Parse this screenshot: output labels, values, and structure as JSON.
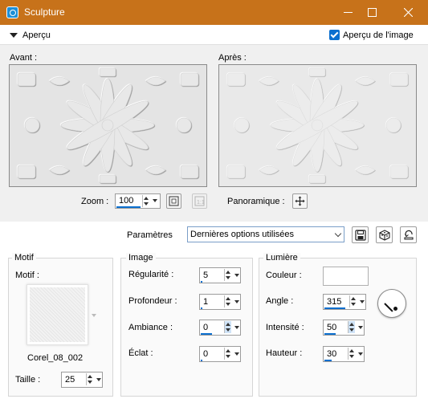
{
  "window": {
    "title": "Sculpture"
  },
  "preview_header": {
    "label": "Aperçu",
    "checkbox_label": "Aperçu de l'image",
    "checkbox_checked": true
  },
  "previews": {
    "before_label": "Avant :",
    "after_label": "Après :"
  },
  "zoom": {
    "label": "Zoom :",
    "value": "100"
  },
  "panoramique": {
    "label": "Panoramique :"
  },
  "parametres": {
    "label": "Paramètres",
    "selected": "Dernières options utilisées"
  },
  "motif": {
    "group_title": "Motif",
    "field_label": "Motif :",
    "pattern_name": "Corel_08_002",
    "size_label": "Taille :",
    "size_value": "25"
  },
  "image": {
    "group_title": "Image",
    "fields": [
      {
        "label": "Régularité :",
        "value": "5",
        "fill": 0.05
      },
      {
        "label": "Profondeur :",
        "value": "1",
        "fill": 0.05
      },
      {
        "label": "Ambiance :",
        "value": "0",
        "fill": 0.5
      },
      {
        "label": "Éclat :",
        "value": "0",
        "fill": 0
      }
    ]
  },
  "lumiere": {
    "group_title": "Lumière",
    "color_label": "Couleur :",
    "color_value": "#ffffff",
    "fields": [
      {
        "label": "Angle :",
        "value": "315",
        "fill": 0.875
      },
      {
        "label": "Intensité :",
        "value": "50",
        "fill": 0.5
      },
      {
        "label": "Hauteur :",
        "value": "30",
        "fill": 0.33
      }
    ]
  },
  "colors": {
    "titlebar": "#c7721a",
    "accent": "#0b6fcf"
  }
}
